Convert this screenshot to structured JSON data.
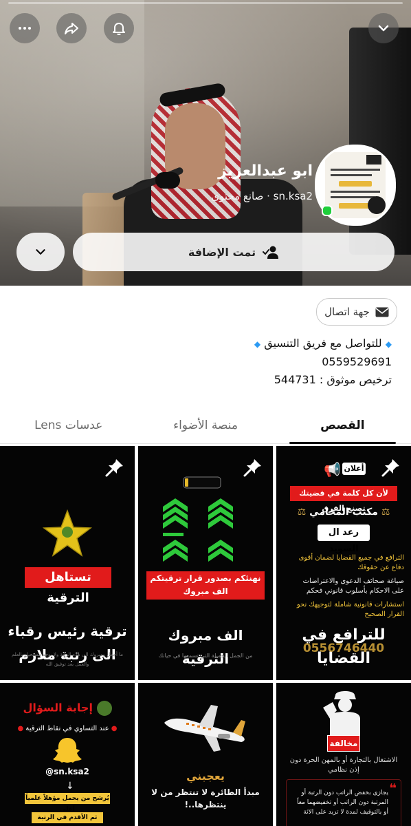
{
  "header": {
    "profile_name": "ابو عبدالعزيز",
    "profile_subtitle": "sn.ksa2 · صانع محتوى",
    "added_label": "تمت الإضافة",
    "icons": [
      "chevron-down-icon",
      "bell-icon",
      "share-icon",
      "more-icon",
      "user-check-icon"
    ]
  },
  "contact": {
    "label": "جهة اتصال"
  },
  "bio": {
    "line1": "للتواصل مع فريق التنسيق",
    "line2": "0559529691",
    "line3": "ترخيص موثوق : 544731"
  },
  "tabs": [
    {
      "label": "القصص",
      "active": true
    },
    {
      "label": "منصة الأضواء",
      "active": false
    },
    {
      "label": "عدسات Lens",
      "active": false
    }
  ],
  "tiles": {
    "t1": {
      "announce": "أعلان",
      "red_line": "لأن كل كلمة في قضيتك تصنع الفرق",
      "office": "مكتب المحامي",
      "name": "رعد ال السويد",
      "bullet1": "الترافع في جميع القضايا لضمان أقوى دفاع عن حقوقك",
      "bullet2": "صياغة صحائف الدعوى والاعتراضات على الاحكام بأسلوب قانوني فحكم",
      "bullet3": "استشارات قانونية شاملة لتوجيهك نحو القرار الصحيح",
      "caption": "للترافع في القضايا",
      "phone": "0556746440"
    },
    "t2": {
      "red_line": "نهنئكم بصدور قرار ترقيتكم الف مبروك",
      "caption": "الف مبروك الترقية",
      "small": "من الجمل الجميلة التي تسمعها في حياتك"
    },
    "t3": {
      "red_line": "تستاهل الترقية",
      "caption": "ترقية رئيس رقباء الى رتبة ملازم",
      "small": "ما أجمل ومبروك الى هذه الرتبة ولا يوجد مستحيل بالعلم والعمل بعد توفيق الله"
    },
    "t4": {
      "red_line": "مخالفة",
      "text1": "الاشتغال بالتجارة أو بالمهن الحرة دون إذن نظامي",
      "text2": "يجازى بخفض الراتب دون الرتبة أو المرتبة دون الراتب أو تخفيضهما معاً أو بالتوقيف لمدة لا تزيد على الاثة"
    },
    "t5": {
      "badge": "يعجبني",
      "caption": "مبدأ الطائرة لا تنتظر من لا ينتظرها..!"
    },
    "t6": {
      "title": "إجابة السؤال",
      "line": "عند التساوي في نقاط الترقية",
      "handle": "@sn.ksa2",
      "yellow1": "يُرشح من يحمل مؤهلاً علمياً أعلى",
      "yellow2": "ثم الأقدم في الرتبة الحالية"
    }
  },
  "colors": {
    "accent_red": "#e11b1b",
    "online": "#1fce3b",
    "chevron_green": "#2ec93b",
    "star_yellow": "#e4c21a"
  }
}
